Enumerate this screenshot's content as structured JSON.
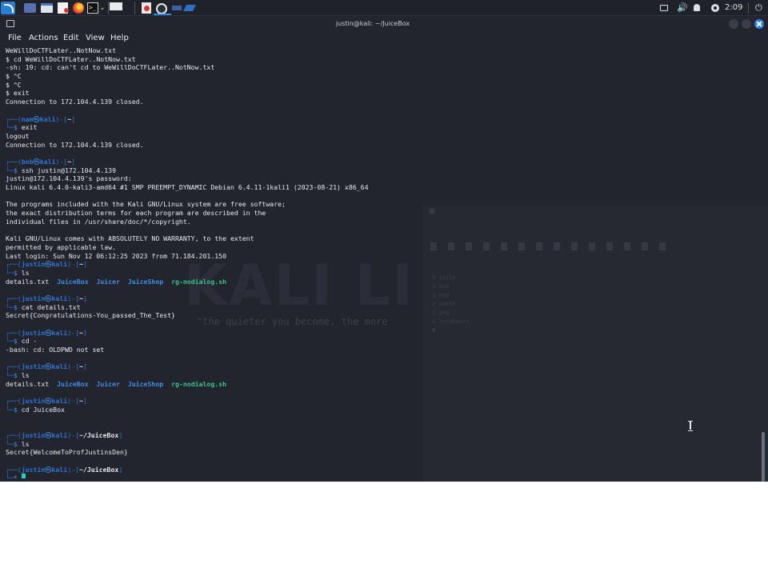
{
  "taskbar": {
    "clock": "2:09",
    "volume_glyph": "🔊",
    "power_glyph": "⏻",
    "chevron_glyph": "⌄",
    "terminal_glyph": ">_"
  },
  "window": {
    "title": "justin@kali: ~/JuiceBox"
  },
  "menu": {
    "file": "File",
    "actions": "Actions",
    "edit": "Edit",
    "view": "View",
    "help": "Help"
  },
  "background": {
    "logo_text": "KALI LI",
    "tagline": "\"the quieter you become, the more",
    "ghost_lines": "$ ittle\n$ ond\n$ nnd\n$ intte\n$ ond\n$ lnfatmsnt\n#"
  },
  "terminal": {
    "lines": [
      {
        "t": "out",
        "text": "WeWillDoCTFLater..NotNow.txt"
      },
      {
        "t": "out",
        "text": "$ cd WeWillDoCTFLater..NotNow.txt"
      },
      {
        "t": "out",
        "text": "-sh: 19: cd: can't cd to WeWillDoCTFLater..NotNow.txt"
      },
      {
        "t": "out",
        "text": "$ ^C"
      },
      {
        "t": "out",
        "text": "$ ^C"
      },
      {
        "t": "out",
        "text": "$ exit"
      },
      {
        "t": "out",
        "text": "Connection to 172.104.4.139 closed."
      },
      {
        "t": "blank"
      },
      {
        "t": "prompt",
        "user": "nam",
        "host": "kali",
        "dir": "~"
      },
      {
        "t": "cmd",
        "text": "exit"
      },
      {
        "t": "out",
        "text": "logout"
      },
      {
        "t": "out",
        "text": "Connection to 172.104.4.139 closed."
      },
      {
        "t": "blank"
      },
      {
        "t": "prompt",
        "user": "bob",
        "host": "kali",
        "dir": "~"
      },
      {
        "t": "cmd",
        "text": "ssh justin@172.104.4.139"
      },
      {
        "t": "out",
        "text": "justin@172.104.4.139's password:"
      },
      {
        "t": "out",
        "text": "Linux kali 6.4.0-kali3-amd64 #1 SMP PREEMPT_DYNAMIC Debian 6.4.11-1kali1 (2023-08-21) x86_64"
      },
      {
        "t": "blank"
      },
      {
        "t": "out",
        "text": "The programs included with the Kali GNU/Linux system are free software;"
      },
      {
        "t": "out",
        "text": "the exact distribution terms for each program are described in the"
      },
      {
        "t": "out",
        "text": "individual files in /usr/share/doc/*/copyright."
      },
      {
        "t": "blank"
      },
      {
        "t": "out",
        "text": "Kali GNU/Linux comes with ABSOLUTELY NO WARRANTY, to the extent"
      },
      {
        "t": "out",
        "text": "permitted by applicable law."
      },
      {
        "t": "out",
        "text": "Last login: Sun Nov 12 06:12:25 2023 from 71.184.201.150"
      },
      {
        "t": "prompt",
        "user": "justin",
        "host": "kali",
        "dir": "~"
      },
      {
        "t": "cmd",
        "text": "ls"
      },
      {
        "t": "ls",
        "items": [
          {
            "name": "details.txt",
            "kind": "file"
          },
          {
            "name": "JuiceBox",
            "kind": "dir"
          },
          {
            "name": "Juicer",
            "kind": "dir"
          },
          {
            "name": "JuiceShop",
            "kind": "dir"
          },
          {
            "name": "rg-nodialog.sh",
            "kind": "exe"
          }
        ]
      },
      {
        "t": "blank"
      },
      {
        "t": "prompt",
        "user": "justin",
        "host": "kali",
        "dir": "~"
      },
      {
        "t": "cmd",
        "text": "cat details.txt"
      },
      {
        "t": "out",
        "text": "Secret{Congratulations-You_passed_The_Test}"
      },
      {
        "t": "blank"
      },
      {
        "t": "prompt",
        "user": "justin",
        "host": "kali",
        "dir": "~"
      },
      {
        "t": "cmd",
        "text": "cd -"
      },
      {
        "t": "out",
        "text": "-bash: cd: OLDPWD not set"
      },
      {
        "t": "blank"
      },
      {
        "t": "prompt",
        "user": "justin",
        "host": "kali",
        "dir": "~"
      },
      {
        "t": "cmd",
        "text": "ls"
      },
      {
        "t": "ls",
        "items": [
          {
            "name": "details.txt",
            "kind": "file"
          },
          {
            "name": "JuiceBox",
            "kind": "dir"
          },
          {
            "name": "Juicer",
            "kind": "dir"
          },
          {
            "name": "JuiceShop",
            "kind": "dir"
          },
          {
            "name": "rg-nodialog.sh",
            "kind": "exe"
          }
        ]
      },
      {
        "t": "blank"
      },
      {
        "t": "prompt",
        "user": "justin",
        "host": "kali",
        "dir": "~"
      },
      {
        "t": "cmd",
        "text": "cd JuiceBox"
      },
      {
        "t": "blank"
      },
      {
        "t": "blank"
      },
      {
        "t": "prompt",
        "user": "justin",
        "host": "kali",
        "dir": "~/JuiceBox"
      },
      {
        "t": "cmd",
        "text": "ls"
      },
      {
        "t": "out",
        "text": "Secret{WelcomeToProfJustinsDen}"
      },
      {
        "t": "blank"
      },
      {
        "t": "prompt",
        "user": "justin",
        "host": "kali",
        "dir": "~/JuiceBox"
      },
      {
        "t": "cursor"
      }
    ]
  }
}
